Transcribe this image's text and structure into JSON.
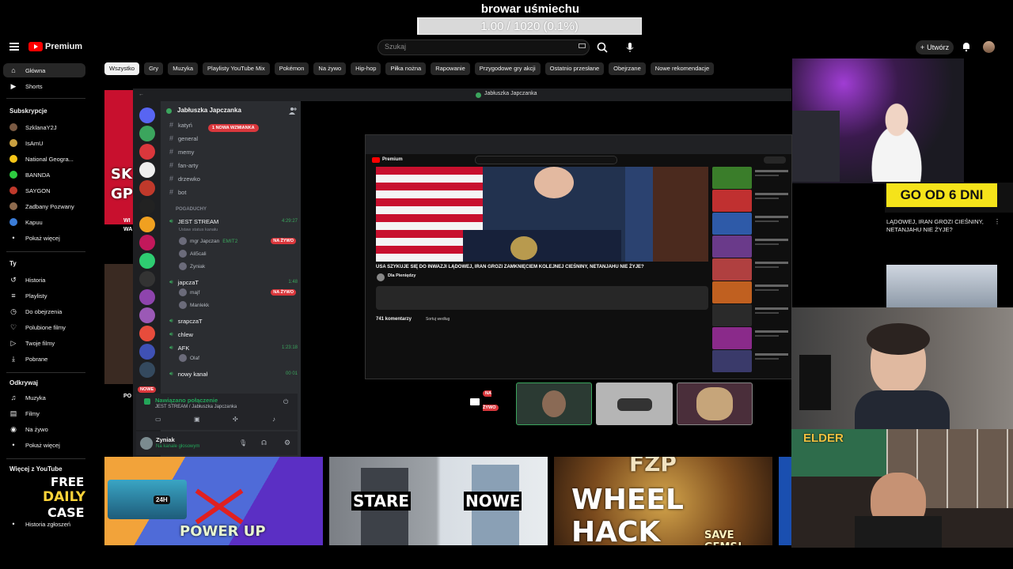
{
  "overlay": {
    "title": "browar uśmiechu",
    "progress_text": "1.00 / 1020 (0.1%)",
    "progress_fraction": 0.001
  },
  "youtube": {
    "brand": "Premium",
    "search_placeholder": "Szukaj",
    "create_label": "Utwórz",
    "chips": [
      "Wszystko",
      "Gry",
      "Muzyka",
      "Playlisty YouTube Mix",
      "Pokémon",
      "Na żywo",
      "Hip-hop",
      "Piłka nożna",
      "Rapowanie",
      "Przygodowe gry akcji",
      "Ostatnio przesłane",
      "Obejrzane",
      "Nowe rekomendacje"
    ],
    "sidebar": {
      "main": [
        {
          "label": "Główna",
          "icon": "home-icon"
        },
        {
          "label": "Shorts",
          "icon": "shorts-icon"
        }
      ],
      "subs_header": "Subskrypcje",
      "subs": [
        {
          "label": "SzklanaY2J",
          "color": "#7a5a43"
        },
        {
          "label": "IsAmU",
          "color": "#c9a040"
        },
        {
          "label": "National Geogra...",
          "color": "#f5c518"
        },
        {
          "label": "BANNDA",
          "color": "#2ecc40"
        },
        {
          "label": "SAYGON",
          "color": "#c0392b"
        },
        {
          "label": "Zadbany Pozwany",
          "color": "#8e6b4e"
        },
        {
          "label": "Kapuu",
          "color": "#3b7dd8"
        }
      ],
      "show_more": "Pokaż więcej",
      "you_header": "Ty",
      "you": [
        {
          "label": "Historia",
          "icon": "history-icon"
        },
        {
          "label": "Playlisty",
          "icon": "playlist-icon"
        },
        {
          "label": "Do obejrzenia",
          "icon": "clock-icon"
        },
        {
          "label": "Polubione filmy",
          "icon": "like-icon"
        },
        {
          "label": "Twoje filmy",
          "icon": "video-icon"
        },
        {
          "label": "Pobrane",
          "icon": "download-icon"
        }
      ],
      "explore_header": "Odkrywaj",
      "explore": [
        {
          "label": "Muzyka",
          "icon": "music-icon"
        },
        {
          "label": "Filmy",
          "icon": "film-icon"
        },
        {
          "label": "Na żywo",
          "icon": "live-icon"
        }
      ],
      "show_more2": "Pokaż więcej",
      "more_header": "Więcej z YouTube",
      "report": "Historia zgłoszeń"
    }
  },
  "discord": {
    "window_title": "Jabłuszka Japczanka",
    "guild_name": "Jabłuszka Japczanka",
    "mention_badge": "1 NOWA WZMIANKA",
    "channels": [
      "katyń",
      "general",
      "memy",
      "fan-arty",
      "drzewko",
      "bot"
    ],
    "category": "POGADUCHY",
    "voice": [
      {
        "name": "JEST STREAM",
        "sub": "Ustaw status kanału",
        "time": "4:29:27",
        "users": [
          {
            "name": "mgr Japczan",
            "tag": "EMIT2",
            "live": "NA ŻYWO"
          },
          {
            "name": "Ali5cali"
          },
          {
            "name": "Zyniak"
          }
        ]
      },
      {
        "name": "japczaT",
        "time": "1:48",
        "users": [
          {
            "name": "majf",
            "live": "NA ŻYWO"
          },
          {
            "name": "Manlekk"
          }
        ]
      },
      {
        "name": "srapczaT"
      },
      {
        "name": "chlew"
      },
      {
        "name": "AFK",
        "time": "1:23:18",
        "users": [
          {
            "name": "Olaf"
          }
        ]
      },
      {
        "name": "nowy kanał",
        "time": "00  01"
      }
    ],
    "connected": "Nawiązano połączenie",
    "connected_sub": "JEST STREAM / Jabłuszka Japczanka",
    "user": "Zyniak",
    "user_status": "Na kanale głosowym",
    "new_badge": "NOWE",
    "tile_live": "NA ŻYWO"
  },
  "inner_video": {
    "brand": "Premium",
    "title": "USA SZYKUJE SIĘ DO INWAZJI LĄDOWEJ, IRAN GROZI ZAMKNIĘCIEM KOLEJNEJ CIEŚNINY, NETANJAHU NIE ŻYJE?",
    "channel": "Dla Pieniędzy",
    "comments": "741 komentarzy",
    "sort": "Sortuj według"
  },
  "right_panel": {
    "banner": "GO OD 6 DNI",
    "title": "LĄDOWEJ, IRAN GROZI CIEŚNINY, NETANJAHU NIE ŻYJE?"
  },
  "thumbnails": {
    "stare": "STARE",
    "nowe": "NOWE",
    "wheel": "WHEEL HACK",
    "save": "SAVE GEMS!",
    "fzp": "FZP",
    "power": "POWER UP",
    "case1": "FREE",
    "case2": "DAILY",
    "case3": "CASE",
    "case_tag": "24H",
    "elder": "ELDER"
  },
  "left_frags": {
    "a": "SK",
    "b": "GP",
    "c": "WI",
    "d": "WA",
    "e": "PO"
  }
}
